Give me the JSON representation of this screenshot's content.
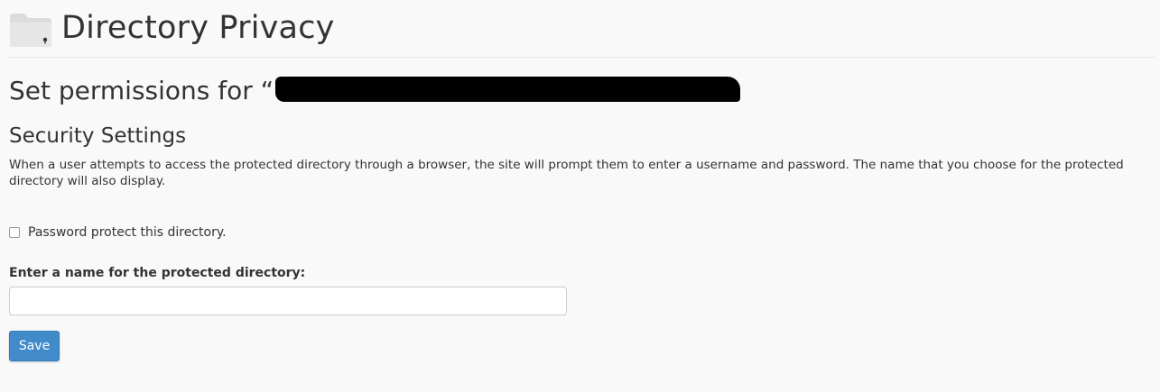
{
  "header": {
    "title": "Directory Privacy",
    "icon": "locked-folder-icon"
  },
  "permissions": {
    "heading_prefix": "Set permissions for “"
  },
  "security": {
    "title": "Security Settings",
    "description": "When a user attempts to access the protected directory through a browser, the site will prompt them to enter a username and password. The name that you choose for the protected directory will also display."
  },
  "form": {
    "checkbox_label": "Password protect this directory.",
    "checkbox_checked": false,
    "name_label": "Enter a name for the protected directory:",
    "name_value": "",
    "save_label": "Save"
  },
  "colors": {
    "background": "#f9f9f9",
    "primary_button": "#428bca",
    "text": "#333333"
  }
}
